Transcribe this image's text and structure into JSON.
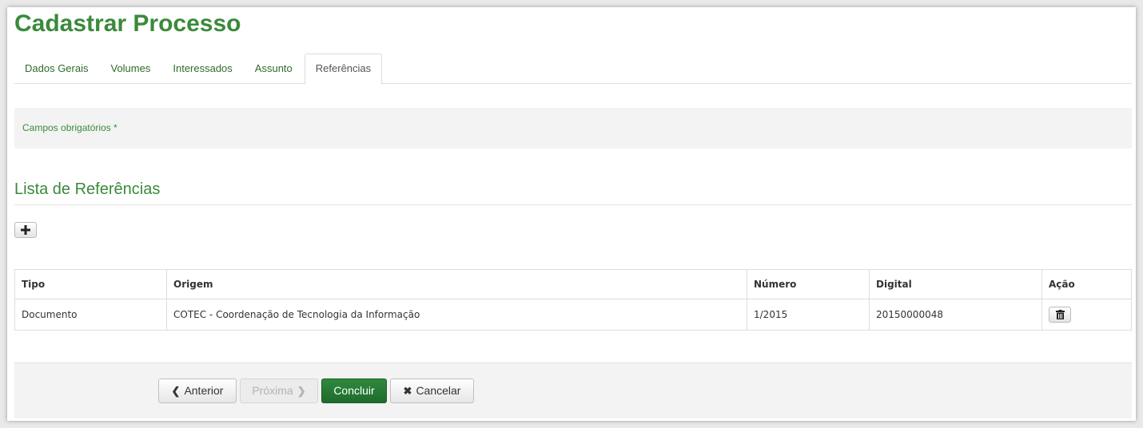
{
  "page": {
    "title": "Cadastrar Processo"
  },
  "tabs": [
    {
      "label": "Dados Gerais",
      "active": false
    },
    {
      "label": "Volumes",
      "active": false
    },
    {
      "label": "Interessados",
      "active": false
    },
    {
      "label": "Assunto",
      "active": false
    },
    {
      "label": "Referências",
      "active": true
    }
  ],
  "alert": {
    "text": "Campos obrigatórios *"
  },
  "section": {
    "title": "Lista de Referências",
    "add_icon": "plus-icon"
  },
  "table": {
    "headers": [
      "Tipo",
      "Origem",
      "Número",
      "Digital",
      "Ação"
    ],
    "rows": [
      {
        "tipo": "Documento",
        "origem": "COTEC - Coordenação de Tecnologia da Informação",
        "numero": "1/2015",
        "digital": "20150000048",
        "action_icon": "trash-icon"
      }
    ]
  },
  "footer": {
    "prev_label": "Anterior",
    "next_label": "Próxima",
    "done_label": "Concluir",
    "cancel_label": "Cancelar"
  },
  "colors": {
    "accent": "#3a8a3a",
    "primary_button": "#1e6b2c"
  }
}
